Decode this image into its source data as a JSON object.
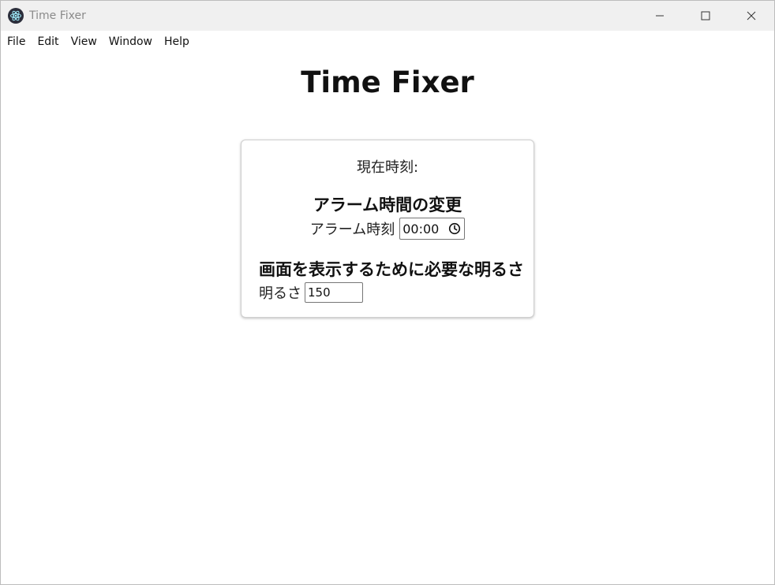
{
  "window": {
    "title": "Time Fixer"
  },
  "menu": {
    "items": [
      "File",
      "Edit",
      "View",
      "Window",
      "Help"
    ]
  },
  "page": {
    "heading": "Time Fixer"
  },
  "card": {
    "current_time_label": "現在時刻:",
    "alarm": {
      "heading": "アラーム時間の変更",
      "label": "アラーム時刻",
      "value": "00:00"
    },
    "brightness": {
      "heading": "画面を表示するために必要な明るさ",
      "label": "明るさ",
      "value": "150"
    }
  },
  "icons": {
    "app": "electron-icon",
    "minimize": "minimize-icon",
    "maximize": "maximize-icon",
    "close": "close-icon",
    "clock": "clock-icon"
  },
  "colors": {
    "titlebar_bg": "#f0f0f0",
    "title_text": "#8a8a8a",
    "app_icon_bg": "#2b2e3b",
    "app_icon_fg": "#9feaf9"
  }
}
